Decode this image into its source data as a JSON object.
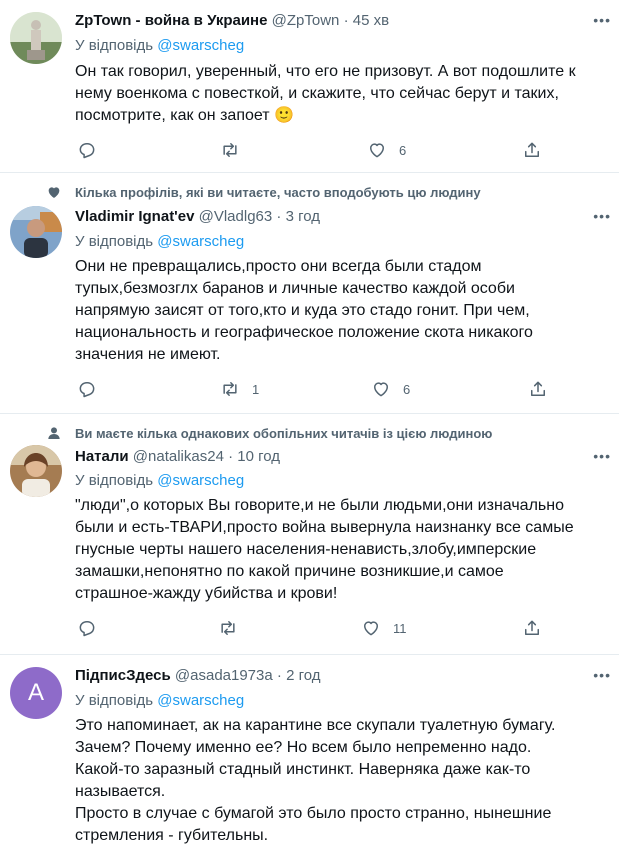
{
  "reply_prefix": "У відповідь",
  "tweets": [
    {
      "name": "ZpTown - война в Украине",
      "handle": "@ZpTown",
      "dot": "·",
      "time": "45 хв",
      "reply_to": "@swarscheg",
      "text": "Он так говорил, уверенный, что его не призовут. А вот подошлите к\nнему военкома с повесткой, и скажите, что сейчас берут и таких,\nпосмотрите, как он запоет 🙂",
      "replies": "",
      "retweets": "",
      "likes": "6"
    },
    {
      "social_context": "Кілька профілів, які ви читаєте, часто вподобують цю людину",
      "name": "Vladimir Ignat'ev",
      "handle": "@Vladlg63",
      "dot": "·",
      "time": "3 год",
      "reply_to": "@swarscheg",
      "text": "Они не превращались,просто они всегда были стадом\nтупых,безмозглх баранов и личные качество каждой особи\nнапрямую заисят от того,кто и куда это стадо гонит. При чем,\nнациональность и географическое положение скота никакого\nзначения не имеют.",
      "replies": "",
      "retweets": "1",
      "likes": "6"
    },
    {
      "social_context": "Ви маєте кілька однакових обопільних читачів із цією людиною",
      "name": "Натали",
      "handle": "@natalikas24",
      "dot": "·",
      "time": "10 год",
      "reply_to": "@swarscheg",
      "text": "\"люди\",о которых Вы говорите,и не были людьми,они изначально\nбыли и есть-ТВАРИ,просто война вывернула  наизнанку все самые\nгнусные черты нашего населения-ненависть,злобу,имперские\nзамашки,непонятно по какой причине возникшие,и самое\nстрашное-жажду убийства и крови!",
      "replies": "",
      "retweets": "",
      "likes": "11"
    },
    {
      "name": "ПідписЗдесь",
      "handle": "@asada1973a",
      "dot": "·",
      "time": "2 год",
      "avatar_letter": "A",
      "avatar_color": "#8e6bc9",
      "reply_to": "@swarscheg",
      "text": "Это напоминает, ак на карантине все скупали туалетную бумагу.\nЗачем? Почему именно ее? Но всем было непременно надо.\nКакой-то заразный стадный инстинкт. Наверняка даже как-то\nназывается.\nПросто в случае с бумагой это было просто странно, нынешние\nстремления -  губительны."
    }
  ],
  "colors": {
    "link": "#1d9bf0",
    "secondary": "#536471",
    "divider": "#e6ecf0"
  }
}
